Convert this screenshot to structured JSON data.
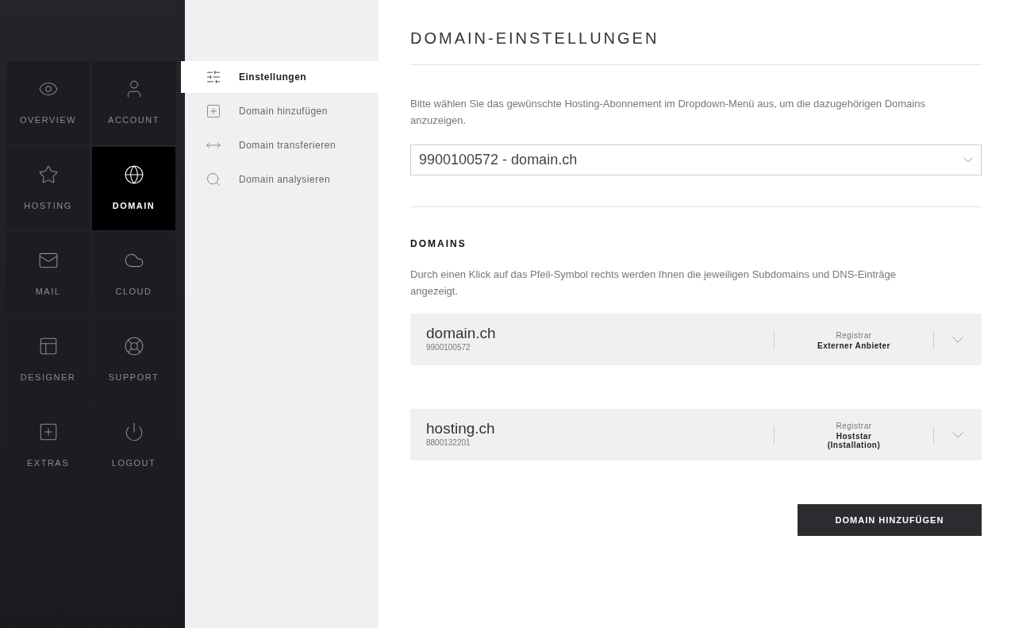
{
  "nav_tiles": [
    {
      "label": "OVERVIEW",
      "selected": false
    },
    {
      "label": "ACCOUNT",
      "selected": false
    },
    {
      "label": "HOSTING",
      "selected": false
    },
    {
      "label": "DOMAIN",
      "selected": true
    },
    {
      "label": "MAIL",
      "selected": false
    },
    {
      "label": "CLOUD",
      "selected": false
    },
    {
      "label": "DESIGNER",
      "selected": false
    },
    {
      "label": "SUPPORT",
      "selected": false
    },
    {
      "label": "EXTRAS",
      "selected": false
    },
    {
      "label": "LOGOUT",
      "selected": false
    }
  ],
  "submenu": [
    {
      "label": "Einstellungen",
      "selected": true
    },
    {
      "label": "Domain hinzufügen",
      "selected": false
    },
    {
      "label": "Domain transferieren",
      "selected": false
    },
    {
      "label": "Domain analysieren",
      "selected": false
    }
  ],
  "page_title": "DOMAIN-EINSTELLUNGEN",
  "intro": "Bitte wählen Sie das gewünschte Hosting-Abonnement im Dropdown-Menü aus, um die dazugehörigen Domains anzuzeigen.",
  "subscription_select": {
    "value": "9900100572 - domain.ch"
  },
  "domains_heading": "DOMAINS",
  "domains_hint": "Durch einen Klick auf das Pfeil-Symbol rechts werden Ihnen die jeweiligen Subdomains und DNS-Einträge angezeigt.",
  "domains": [
    {
      "name": "domain.ch",
      "number": "9900100572",
      "registrar_label": "Registrar",
      "registrar": [
        "Externer Anbieter"
      ]
    },
    {
      "name": "hosting.ch",
      "number": "8800132201",
      "registrar_label": "Registrar",
      "registrar": [
        "Hoststar",
        "(Installation)"
      ]
    }
  ],
  "add_button": "DOMAIN HINZUFÜGEN"
}
